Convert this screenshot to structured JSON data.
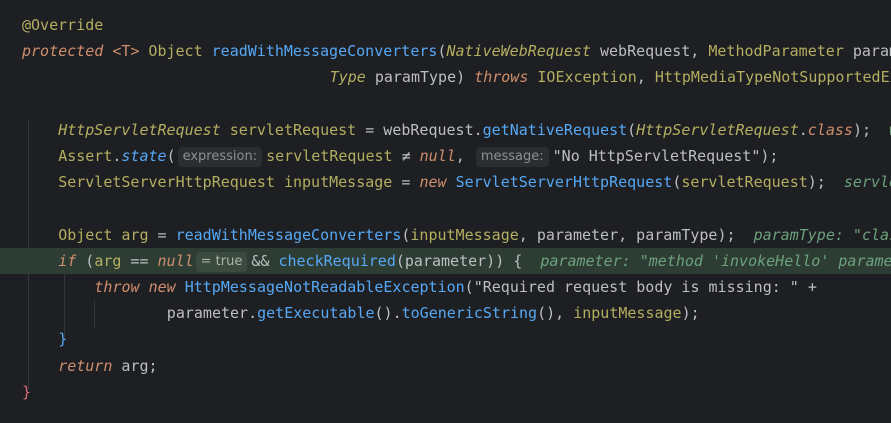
{
  "editor": {
    "lines": [
      {
        "indent": 0,
        "tokens": [
          {
            "t": "@Override",
            "c": "t-ann"
          }
        ]
      },
      {
        "indent": 0,
        "tokens": [
          {
            "t": "protected",
            "c": "t-kw"
          },
          {
            "t": " ",
            "c": "t-plain"
          },
          {
            "t": "<T>",
            "c": "t-kw-plain"
          },
          {
            "t": " Object ",
            "c": "t-type"
          },
          {
            "t": "readWithMessageConverters",
            "c": "t-method"
          },
          {
            "t": "(",
            "c": "t-punct"
          },
          {
            "t": "NativeWebRequest",
            "c": "t-ital-type"
          },
          {
            "t": " webRequest, ",
            "c": "t-plain"
          },
          {
            "t": "MethodParameter",
            "c": "t-type"
          },
          {
            "t": " parameter,",
            "c": "t-plain"
          }
        ]
      },
      {
        "indent": 34,
        "tokens": [
          {
            "t": "Type",
            "c": "t-ital-type"
          },
          {
            "t": " paramType) ",
            "c": "t-plain"
          },
          {
            "t": "throws",
            "c": "t-kw"
          },
          {
            "t": " ",
            "c": "t-plain"
          },
          {
            "t": "IOException",
            "c": "t-type"
          },
          {
            "t": ", ",
            "c": "t-plain"
          },
          {
            "t": "HttpMediaTypeNotSupportedException",
            "c": "t-type"
          }
        ]
      },
      {
        "indent": 0,
        "tokens": []
      },
      {
        "indent": 4,
        "tokens": [
          {
            "t": "HttpServletRequest",
            "c": "t-ital-type"
          },
          {
            "t": " ",
            "c": "t-plain"
          },
          {
            "t": "servletRequest",
            "c": "t-type"
          },
          {
            "t": " = webRequest.",
            "c": "t-plain"
          },
          {
            "t": "getNativeRequest",
            "c": "t-method"
          },
          {
            "t": "(",
            "c": "t-punct"
          },
          {
            "t": "HttpServletRequest",
            "c": "t-ital-type"
          },
          {
            "t": ".",
            "c": "t-plain"
          },
          {
            "t": "class",
            "c": "t-kw"
          },
          {
            "t": ");  ",
            "c": "t-plain"
          },
          {
            "t": "webRequest: ",
            "c": "t-debug"
          }
        ]
      },
      {
        "indent": 4,
        "tokens": [
          {
            "t": "Assert",
            "c": "t-type"
          },
          {
            "t": ".",
            "c": "t-plain"
          },
          {
            "t": "state",
            "c": "t-static"
          },
          {
            "t": "(",
            "c": "t-punct"
          },
          {
            "hint": "expression:"
          },
          {
            "t": "servletRequest",
            "c": "t-type"
          },
          {
            "t": " ≠ ",
            "c": "t-op"
          },
          {
            "t": "null",
            "c": "t-kw"
          },
          {
            "t": ", ",
            "c": "t-plain"
          },
          {
            "hint": "message:"
          },
          {
            "t": "\"No HttpServletRequest\"",
            "c": "t-plain"
          },
          {
            "t": ");",
            "c": "t-plain"
          }
        ]
      },
      {
        "indent": 4,
        "tokens": [
          {
            "t": "ServletServerHttpRequest",
            "c": "t-type"
          },
          {
            "t": " ",
            "c": "t-plain"
          },
          {
            "t": "inputMessage",
            "c": "t-type"
          },
          {
            "t": " = ",
            "c": "t-plain"
          },
          {
            "t": "new",
            "c": "t-kw"
          },
          {
            "t": " ",
            "c": "t-plain"
          },
          {
            "t": "ServletServerHttpRequest",
            "c": "t-method"
          },
          {
            "t": "(",
            "c": "t-punct"
          },
          {
            "t": "servletRequest",
            "c": "t-type"
          },
          {
            "t": ");  ",
            "c": "t-plain"
          },
          {
            "t": "servletRequest",
            "c": "t-debug"
          }
        ]
      },
      {
        "indent": 0,
        "tokens": []
      },
      {
        "indent": 4,
        "tokens": [
          {
            "t": "Object",
            "c": "t-type"
          },
          {
            "t": " ",
            "c": "t-plain"
          },
          {
            "t": "arg",
            "c": "t-type"
          },
          {
            "t": " = ",
            "c": "t-plain"
          },
          {
            "t": "readWithMessageConverters",
            "c": "t-method"
          },
          {
            "t": "(",
            "c": "t-punct"
          },
          {
            "t": "inputMessage",
            "c": "t-type"
          },
          {
            "t": ", parameter, paramType);  ",
            "c": "t-plain"
          },
          {
            "t": "paramType: \"class",
            "c": "t-debug"
          }
        ]
      },
      {
        "indent": 4,
        "exec": true,
        "tokens": [
          {
            "t": "if",
            "c": "t-kw"
          },
          {
            "t": " (",
            "c": "t-plain"
          },
          {
            "t": "arg",
            "c": "t-type"
          },
          {
            "t": " == ",
            "c": "t-op"
          },
          {
            "t": "null",
            "c": "t-kw"
          },
          {
            "hint": "= true",
            "bool": true
          },
          {
            "t": "&& ",
            "c": "t-op"
          },
          {
            "t": "checkRequired",
            "c": "t-method"
          },
          {
            "t": "(parameter)",
            "c": "t-plain"
          },
          {
            "t": ") {  ",
            "c": "t-plain"
          },
          {
            "t": "parameter: \"method 'invokeHello' parame",
            "c": "t-debug"
          }
        ]
      },
      {
        "indent": 8,
        "tokens": [
          {
            "t": "throw",
            "c": "t-kw"
          },
          {
            "t": " ",
            "c": "t-plain"
          },
          {
            "t": "new",
            "c": "t-kw"
          },
          {
            "t": " ",
            "c": "t-plain"
          },
          {
            "t": "HttpMessageNotReadableException",
            "c": "t-method"
          },
          {
            "t": "(",
            "c": "t-punct"
          },
          {
            "t": "\"Required request body is missing: \"",
            "c": "t-plain"
          },
          {
            "t": " +",
            "c": "t-plain"
          }
        ]
      },
      {
        "indent": 16,
        "tokens": [
          {
            "t": "parameter.",
            "c": "t-plain"
          },
          {
            "t": "getExecutable",
            "c": "t-method"
          },
          {
            "t": "().",
            "c": "t-plain"
          },
          {
            "t": "toGenericString",
            "c": "t-method"
          },
          {
            "t": "(), ",
            "c": "t-plain"
          },
          {
            "t": "inputMessage",
            "c": "t-type"
          },
          {
            "t": ");",
            "c": "t-plain"
          }
        ]
      },
      {
        "indent": 4,
        "tokens": [
          {
            "t": "}",
            "c": "t-method"
          }
        ]
      },
      {
        "indent": 4,
        "tokens": [
          {
            "t": "return",
            "c": "t-kw"
          },
          {
            "t": " arg;",
            "c": "t-plain"
          }
        ]
      },
      {
        "indent": 0,
        "tokens": [
          {
            "t": "}",
            "c": "t-brace"
          }
        ]
      }
    ]
  }
}
